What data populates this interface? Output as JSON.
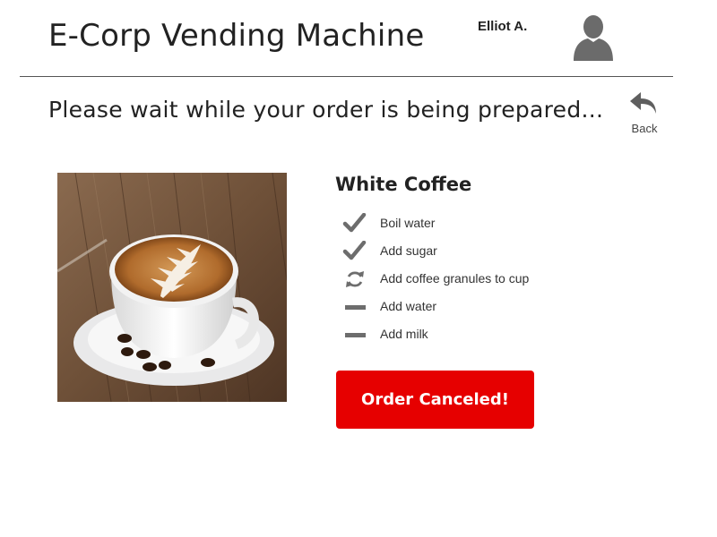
{
  "header": {
    "title": "E-Corp Vending Machine",
    "user_name": "Elliot A.",
    "avatar_icon": "user-silhouette-icon"
  },
  "status": {
    "message": "Please wait while your order is being prepared..."
  },
  "back": {
    "label": "Back",
    "icon": "back-arrow-icon"
  },
  "product": {
    "name": "White Coffee",
    "image": "coffee-cup-latte-art"
  },
  "steps": [
    {
      "label": "Boil water",
      "state": "done",
      "icon": "checkmark-icon"
    },
    {
      "label": "Add sugar",
      "state": "done",
      "icon": "checkmark-icon"
    },
    {
      "label": "Add coffee granules to cup",
      "state": "in-progress",
      "icon": "refresh-icon"
    },
    {
      "label": "Add water",
      "state": "pending",
      "icon": "dash-icon"
    },
    {
      "label": "Add milk",
      "state": "pending",
      "icon": "dash-icon"
    }
  ],
  "order_button": {
    "label": "Order Canceled!"
  },
  "colors": {
    "button_bg": "#e60000",
    "button_text": "#ffffff",
    "icon_gray": "#6d6d6d",
    "divider": "#555555"
  }
}
